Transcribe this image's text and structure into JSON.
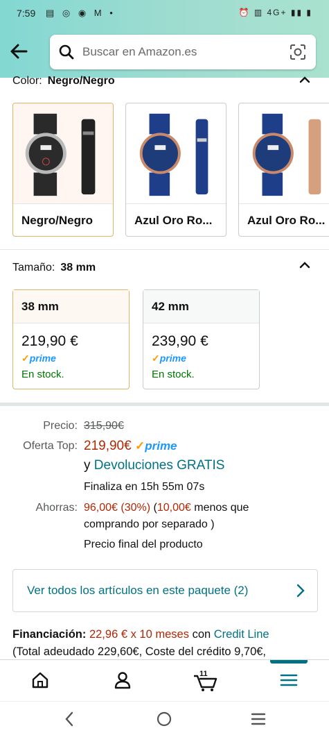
{
  "status_bar": {
    "time": "7:59",
    "notifications": "▤ ◎ ◉ M •",
    "right": "⏰ ▥ 4G+ ▮▮ ▮"
  },
  "search": {
    "placeholder": "Buscar en Amazon.es"
  },
  "color": {
    "label": "Color:",
    "selected": "Negro/Negro",
    "options": [
      {
        "label": "Negro/Negro",
        "dial": "#2b2b2b",
        "case": "#b9b9b9",
        "strap": "#222222"
      },
      {
        "label": "Azul Oro Ro...",
        "dial": "#1e3b7a",
        "case": "#c98a6b",
        "strap": "#1f3e8a"
      },
      {
        "label": "Azul Oro Ro...",
        "dial": "#1e3b7a",
        "case": "#c98a6b",
        "strap": "#d4a07d"
      }
    ]
  },
  "size": {
    "label": "Tamaño:",
    "selected": "38 mm",
    "options": [
      {
        "name": "38 mm",
        "price": "219,90 €",
        "prime": "prime",
        "stock": "En stock."
      },
      {
        "name": "42 mm",
        "price": "239,90 €",
        "prime": "prime",
        "stock": "En stock."
      }
    ]
  },
  "pricing": {
    "precio_label": "Precio:",
    "precio_value": "315,90€",
    "oferta_label": "Oferta Top:",
    "oferta_value": "219,90€",
    "oferta_prime": "prime",
    "devoluciones_prefix": "y",
    "devoluciones_link": "Devoluciones GRATIS",
    "finaliza": "Finaliza en 15h 55m 07s",
    "ahorras_label": "Ahorras:",
    "ahorras_value": "96,00€ (30%)",
    "ahorras_open": "(",
    "ahorras_extra": "10,00€",
    "ahorras_text1": "menos que",
    "ahorras_text2": "comprando por separado )",
    "precio_final": "Precio final del producto"
  },
  "bundle": {
    "label": "Ver todos los artículos en este paquete (2)"
  },
  "financing": {
    "label": "Financiación:",
    "amount": "22,96 € x 10 meses",
    "con": "con",
    "provider": "Credit Line",
    "line2": "(Total adeudado 229,60€, Coste del crédito 9,70€,"
  },
  "bottom_nav": {
    "cart_count": "11"
  },
  "colors": {
    "accent": "#007185",
    "price_red": "#b12704",
    "prime_blue": "#1a98ff",
    "stock_green": "#007600",
    "selected_border": "#e0b466"
  }
}
